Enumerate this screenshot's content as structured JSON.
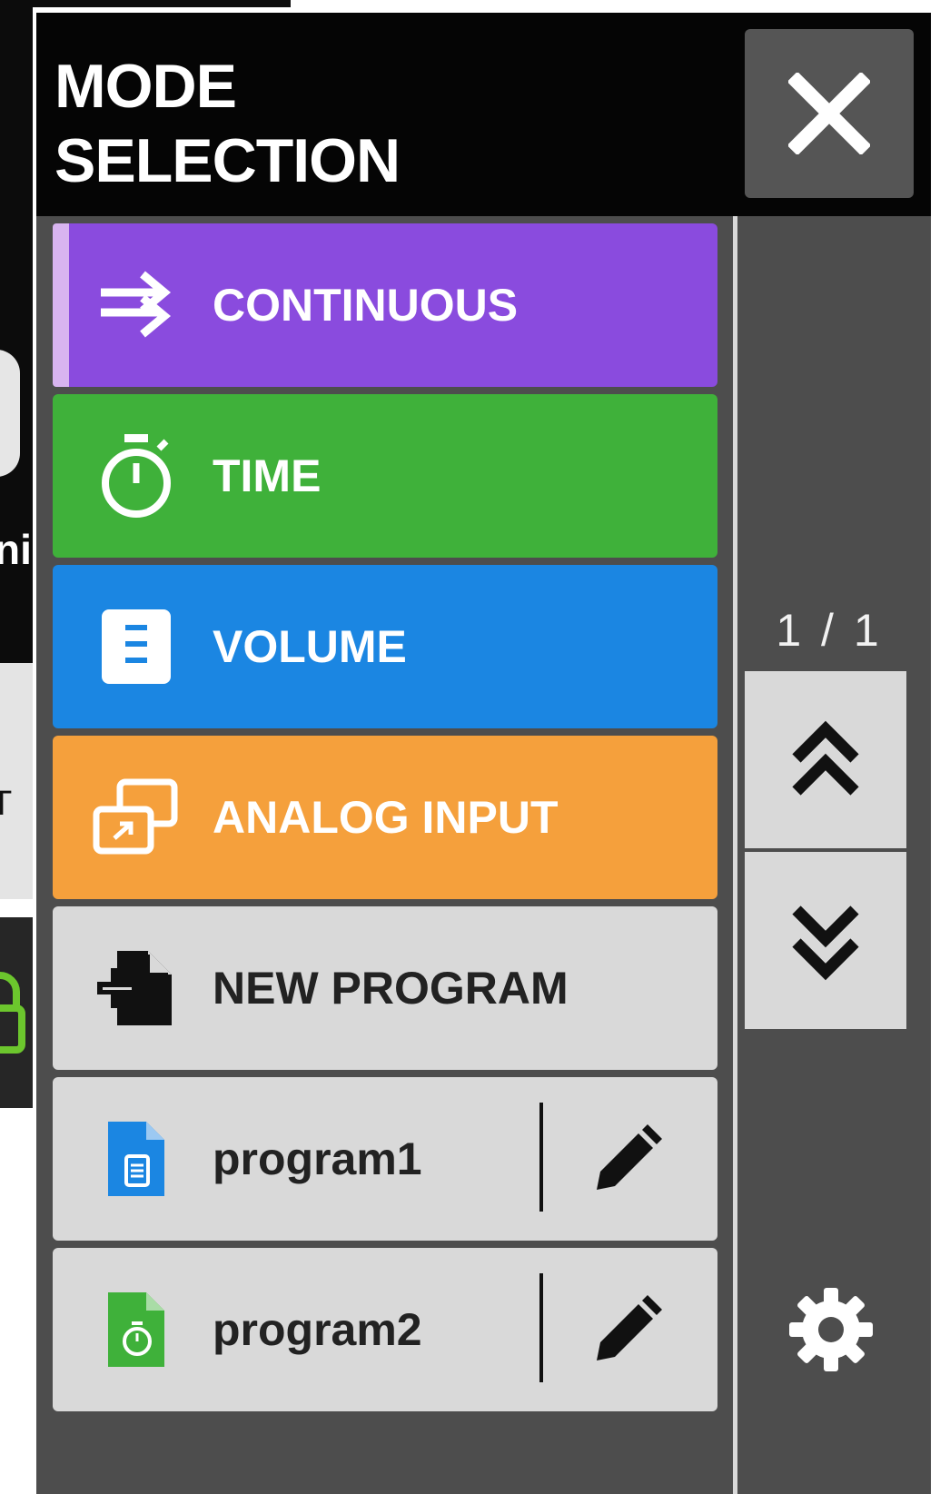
{
  "header": {
    "title": "MODE\nSELECTION",
    "close_icon": "close-icon"
  },
  "modes": [
    {
      "label": "CONTINUOUS",
      "icon": "swap-arrows-icon",
      "color": "#8a4bde",
      "selected": true
    },
    {
      "label": "TIME",
      "icon": "stopwatch-icon",
      "color": "#3fb13a"
    },
    {
      "label": "VOLUME",
      "icon": "volume-document-icon",
      "color": "#1b86e2"
    },
    {
      "label": "ANALOG INPUT",
      "icon": "analog-input-icon",
      "color": "#f5a03c"
    },
    {
      "label": "NEW PROGRAM",
      "icon": "new-file-icon",
      "color": "#d9d9d9"
    }
  ],
  "programs": [
    {
      "label": "program1",
      "icon": "volume-program-file-icon",
      "icon_color": "#1b86e2",
      "edit_icon": "pencil-icon"
    },
    {
      "label": "program2",
      "icon": "time-program-file-icon",
      "icon_color": "#3fb13a",
      "edit_icon": "pencil-icon"
    }
  ],
  "sidebar": {
    "page_indicator": "1 / 1",
    "scroll_up_icon": "double-chevron-up-icon",
    "scroll_down_icon": "double-chevron-down-icon",
    "settings_icon": "gear-icon"
  },
  "background_app": {
    "partial_text_1": "ni",
    "partial_text_2": "T",
    "lock_icon": "lock-icon",
    "lock_color": "#6cc62d"
  },
  "colors": {
    "header_bg": "#050505",
    "panel_bg": "#4d4d4d",
    "item_light_bg": "#d9d9d9",
    "selected_accent": "#d8b4f0"
  }
}
